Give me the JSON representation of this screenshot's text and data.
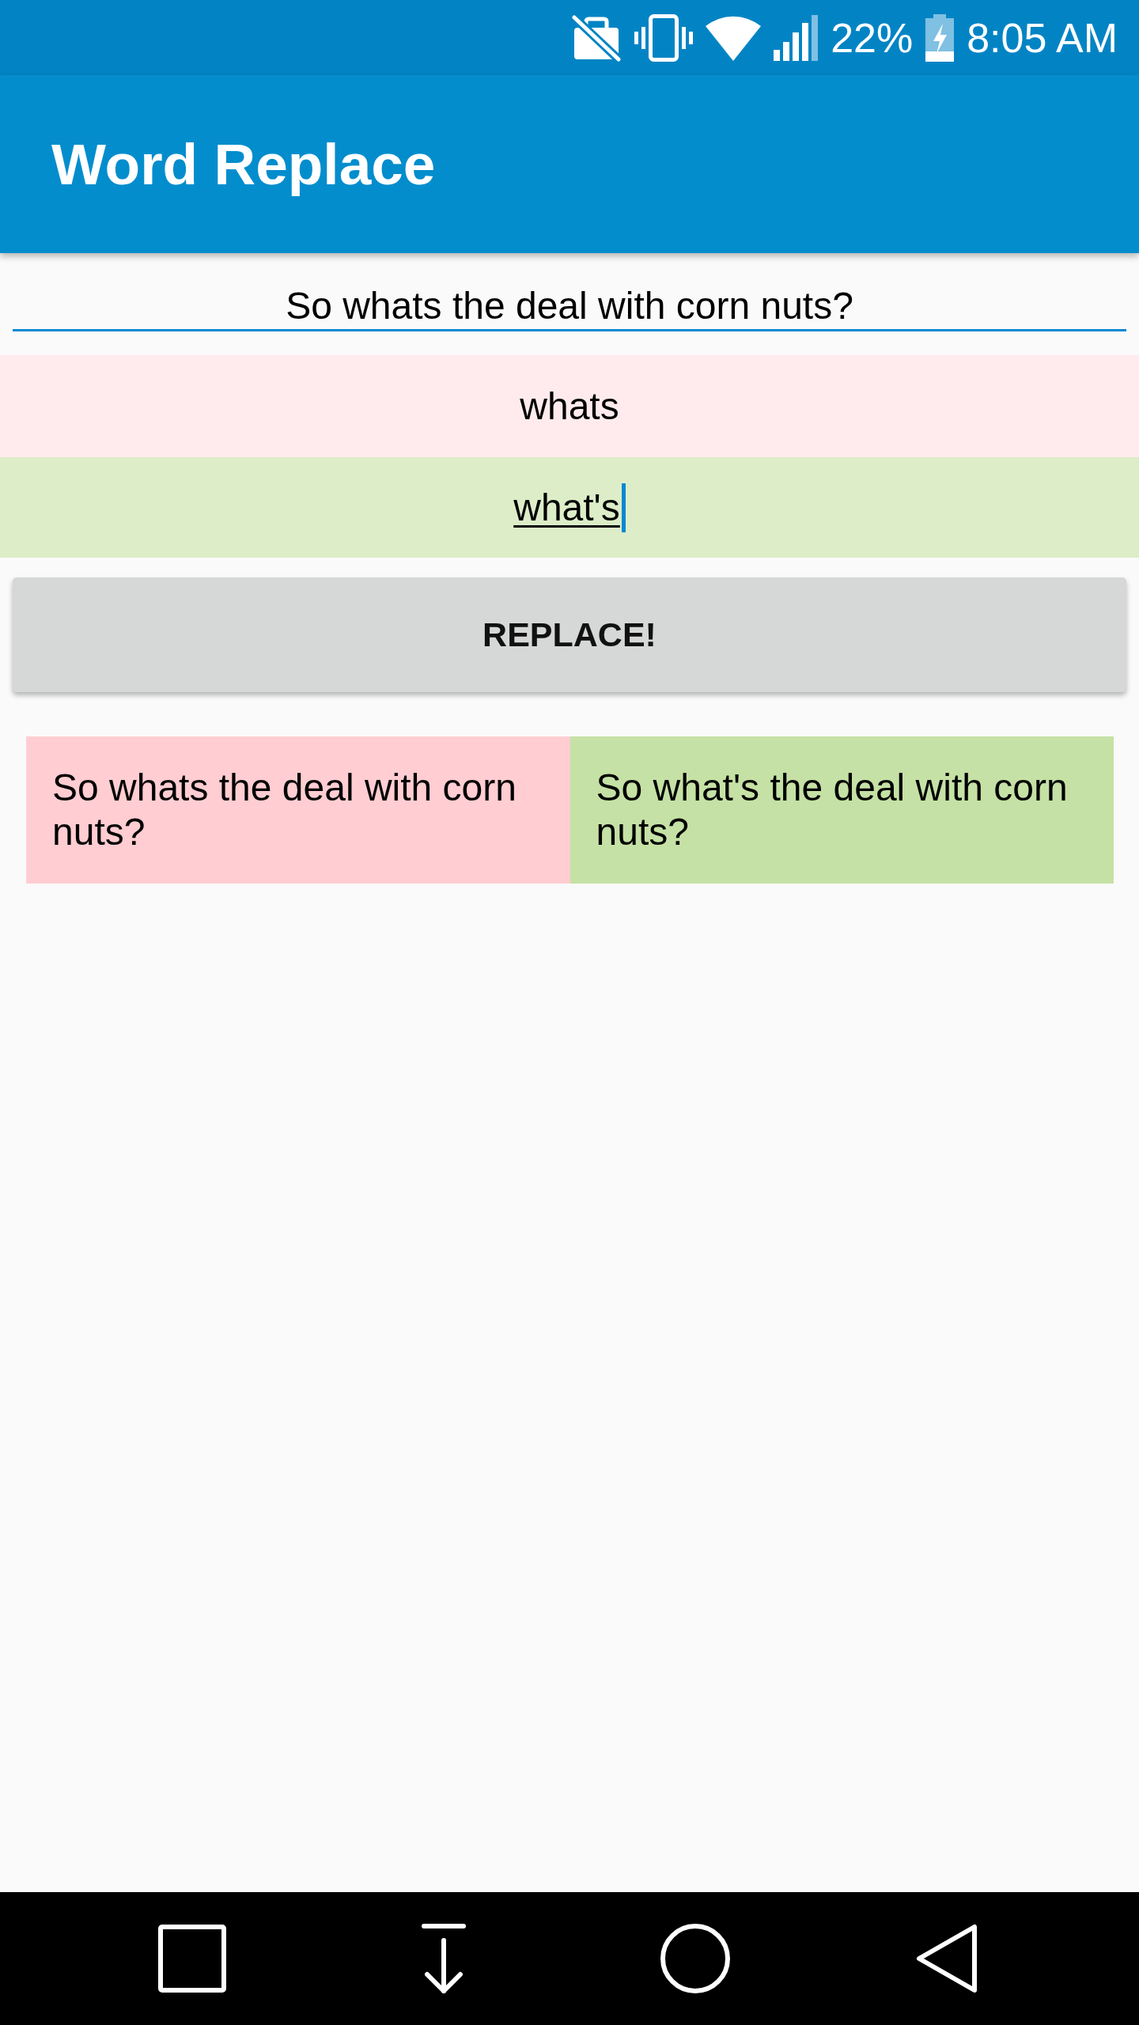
{
  "status_bar": {
    "battery_percent": "22%",
    "time": "8:05 AM"
  },
  "app_bar": {
    "title": "Word Replace"
  },
  "form": {
    "sentence_field": {
      "value": "So whats the deal with corn nuts?",
      "focused": false
    },
    "find_field": {
      "value": "whats",
      "focused": false
    },
    "replace_field": {
      "value": "what's",
      "focused": true
    },
    "replace_button": {
      "label": "REPLACE!"
    }
  },
  "results": [
    {
      "kind": "original",
      "text": "So whats the deal with corn nuts?"
    },
    {
      "kind": "replaced",
      "text": "So what's the deal with corn nuts?"
    }
  ]
}
